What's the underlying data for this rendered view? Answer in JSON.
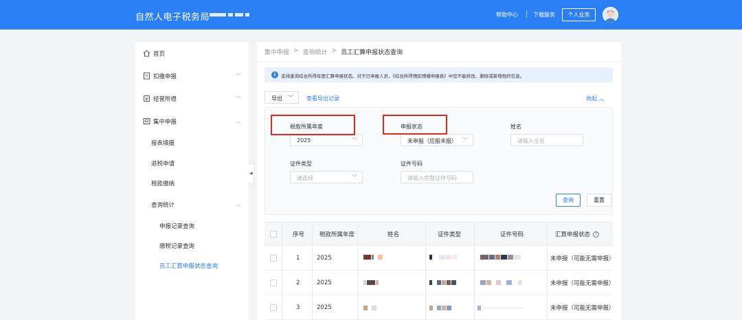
{
  "header": {
    "brand": "自然人电子税务局",
    "help_label": "帮助中心",
    "download_label": "下载服务",
    "biz_label": "个人业务"
  },
  "sidebar": {
    "items": [
      {
        "label": "首页",
        "icon": "home-icon",
        "expand": ""
      },
      {
        "label": "扣缴申报",
        "icon": "withholding-icon",
        "expand": "﹀"
      },
      {
        "label": "经营所得",
        "icon": "business-income-icon",
        "expand": "﹀"
      },
      {
        "label": "集中申报",
        "icon": "centralized-icon",
        "expand": "︿"
      },
      {
        "label": "报表填报"
      },
      {
        "label": "退税申请"
      },
      {
        "label": "税款缴纳"
      },
      {
        "label": "查询统计",
        "expand": "︿"
      },
      {
        "label": "申报记录查询"
      },
      {
        "label": "缴税记录查询"
      },
      {
        "label": "员工汇算申报状态查询"
      }
    ]
  },
  "breadcrumb": [
    "集中申报",
    "查询统计",
    "员工汇算申报状态查询"
  ],
  "breadcrumb_sep": ">",
  "info": "支持查询综合所得年度汇算申报状态。对于已申报人员，《综合所得预扣预缴申报表》中您不能修改、删除或新增他的信息。",
  "toolbar": {
    "export_label": "导出",
    "export_record_label": "查看导出记录",
    "collapse_label": "收起"
  },
  "filters": {
    "tax_year_label": "税款所属年度",
    "tax_year_value": "2025",
    "status_label": "申报状态",
    "status_value": "未申报（应报未报）",
    "name_label": "姓名",
    "name_placeholder": "请输入全名",
    "id_type_label": "证件类型",
    "id_type_placeholder": "请选择",
    "id_no_label": "证件号码",
    "id_no_placeholder": "请输入完整证件号码",
    "query_label": "查询",
    "reset_label": "重置"
  },
  "table": {
    "headers": [
      "序号",
      "税款所属年度",
      "姓名",
      "证件类型",
      "证件号码",
      "汇算申报状态"
    ],
    "rows": [
      {
        "index": "1",
        "year": "2025",
        "status": "未申报（可能无需申报）"
      },
      {
        "index": "2",
        "year": "2025",
        "status": "未申报（可能无需申报）"
      },
      {
        "index": "3",
        "year": "2025",
        "status": "未申报（可能无需申报）"
      }
    ]
  },
  "colors": {
    "accent": "#2a7ff5",
    "highlight": "#e8261c"
  }
}
